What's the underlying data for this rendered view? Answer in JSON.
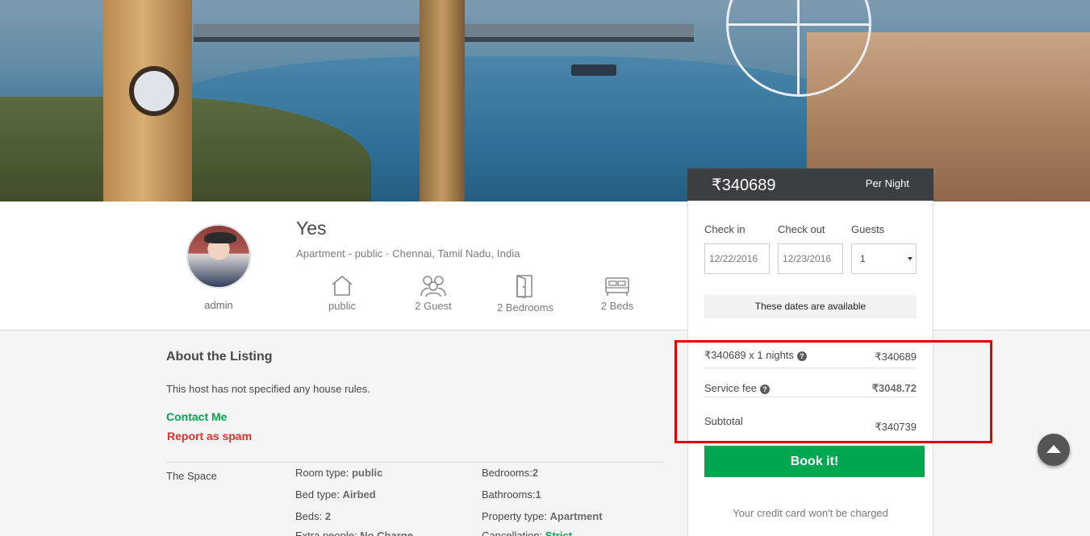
{
  "host": {
    "name": "admin"
  },
  "listing": {
    "title": "Yes",
    "subtitle": "Apartment - public · Chennai, Tamil Nadu, India"
  },
  "features": [
    {
      "icon": "house-icon",
      "label": "public"
    },
    {
      "icon": "guests-icon",
      "label": "2 Guest"
    },
    {
      "icon": "door-icon",
      "label": "2 Bedrooms"
    },
    {
      "icon": "bed-icon",
      "label": "2 Beds"
    }
  ],
  "about": {
    "title": "About the Listing",
    "rules": "This host has not specified any house rules.",
    "contact_label": "Contact Me",
    "spam_label": "Report as spam"
  },
  "space": {
    "label": "The Space",
    "col1": [
      {
        "key": "Room type: ",
        "value": "public"
      },
      {
        "key": "Bed type: ",
        "value": "Airbed"
      },
      {
        "key": "Beds: ",
        "value": "2"
      },
      {
        "key": "Extra people: ",
        "value": "No Charge"
      }
    ],
    "col2": [
      {
        "key": "Bedrooms:",
        "value": "2"
      },
      {
        "key": "Bathrooms:",
        "value": "1"
      },
      {
        "key": "Property type: ",
        "value": "Apartment"
      },
      {
        "key": "Cancellation: ",
        "value": "Strict"
      }
    ]
  },
  "booking": {
    "price": "₹340689",
    "per_night": "Per Night",
    "check_in_label": "Check in",
    "check_out_label": "Check out",
    "guests_label": "Guests",
    "check_in_value": "12/22/2016",
    "check_out_value": "12/23/2016",
    "guests_value": "1",
    "availability": "These dates are available",
    "nights_label": "₹340689 x 1 nights",
    "nights_value": "₹340689",
    "service_label": "Service fee",
    "service_value": "₹3048.72",
    "subtotal_label": "Subtotal",
    "subtotal_value": "₹340739",
    "book_label": "Book it!",
    "no_charge": "Your credit card won't be charged"
  },
  "colors": {
    "accent_green": "#00a650",
    "spam_red": "#e3312f",
    "highlight_red": "#e00000",
    "price_bar": "#3c3f42"
  }
}
